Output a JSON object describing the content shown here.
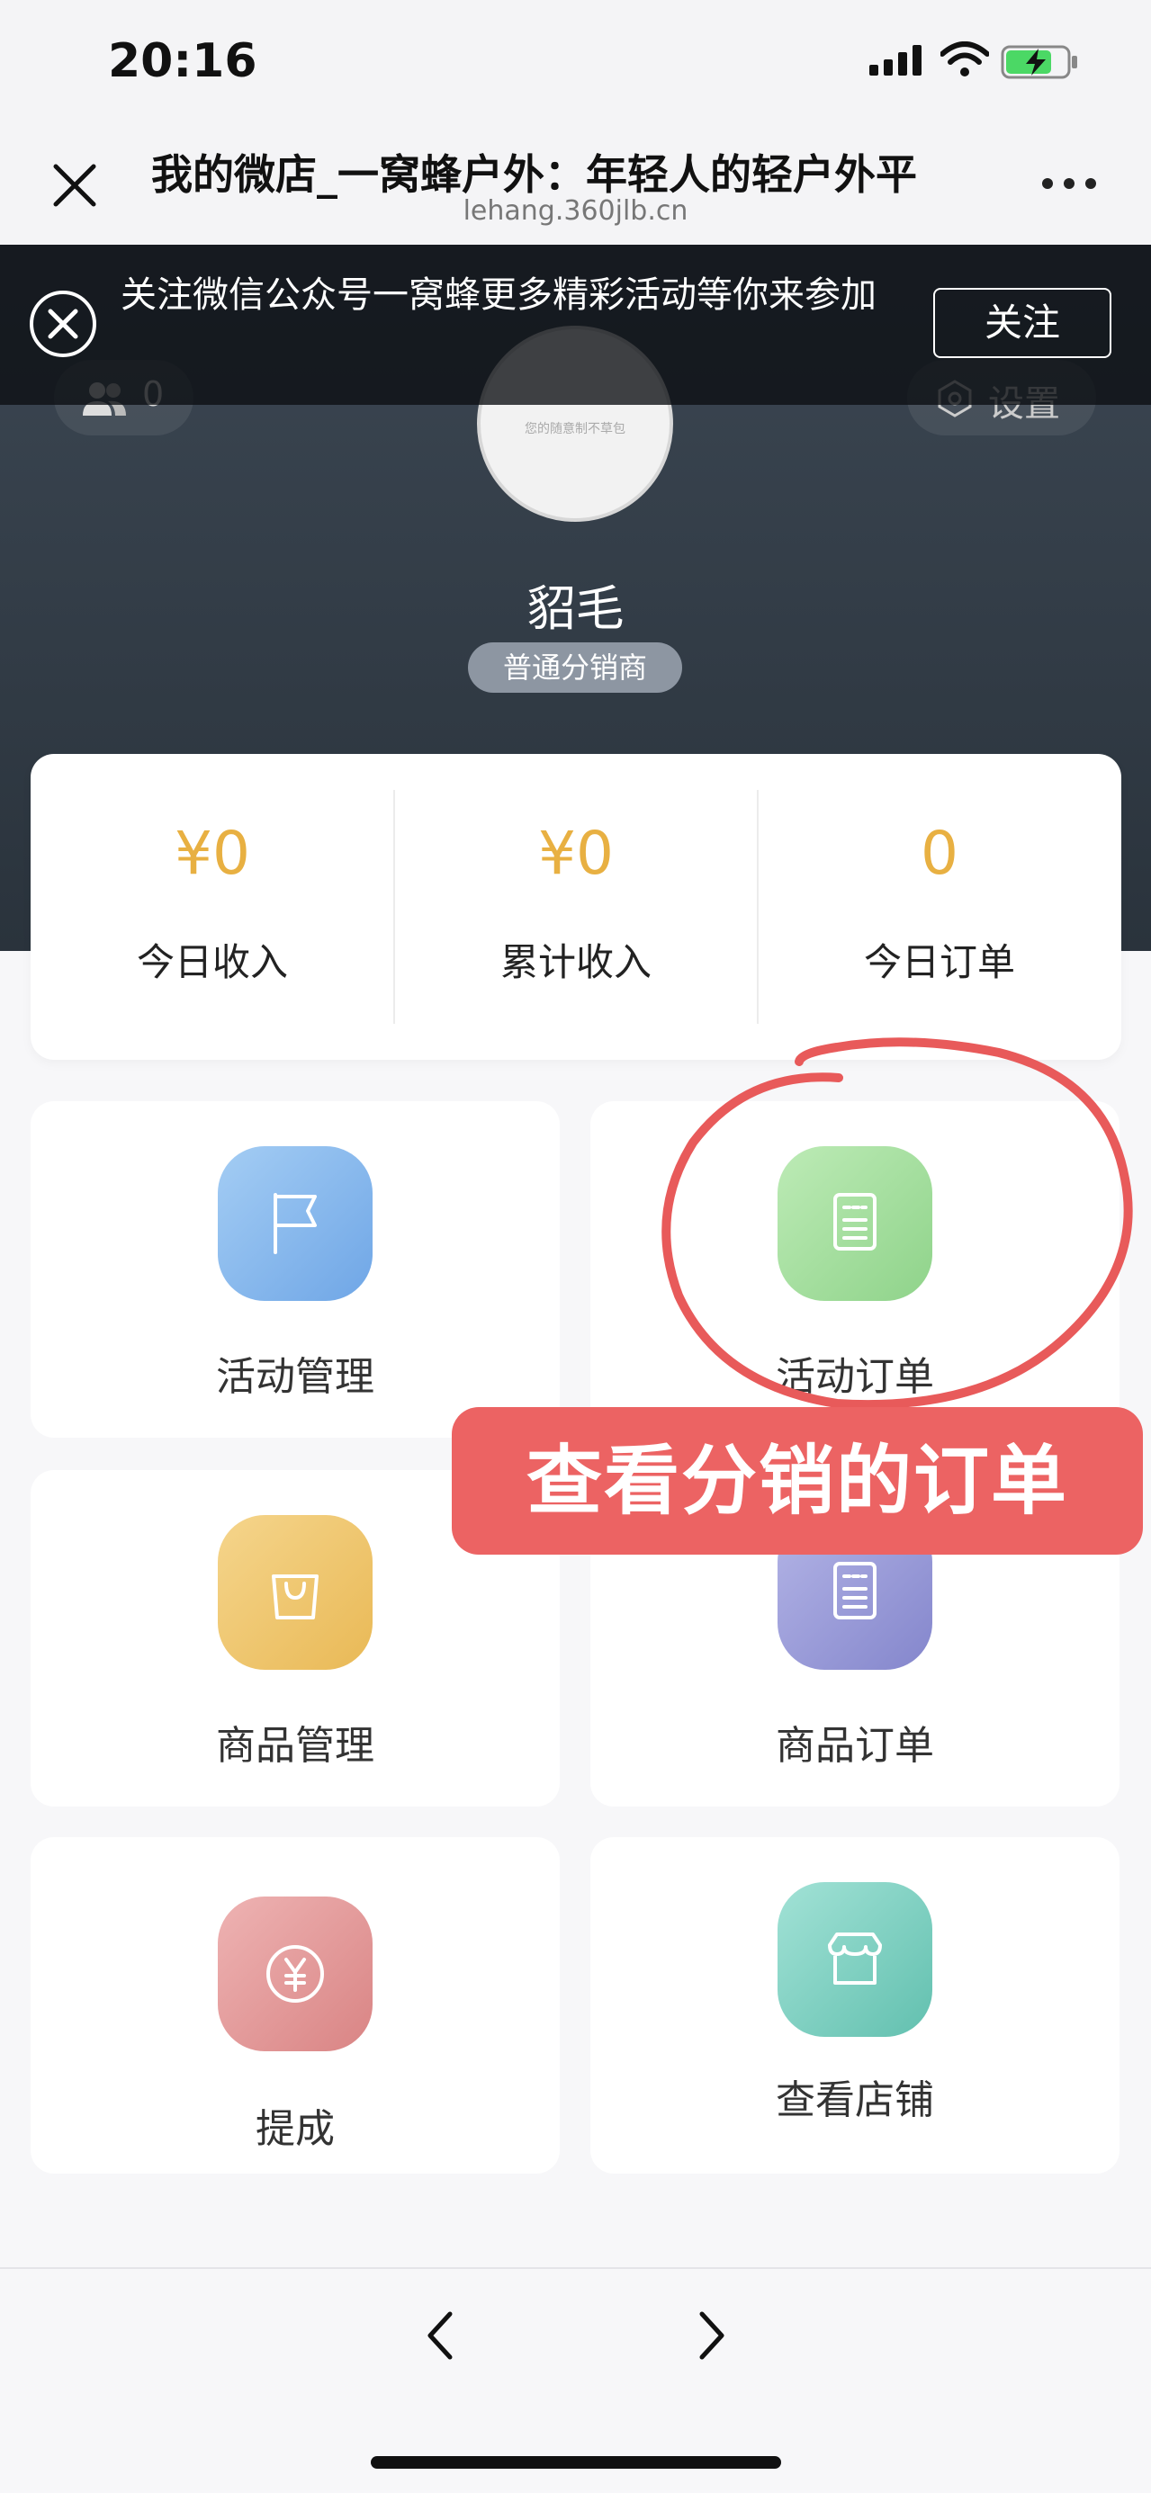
{
  "status_bar": {
    "time": "20:16"
  },
  "nav_bar": {
    "title": "我的微店_一窝蜂户外：年轻人的轻户外平",
    "url": "lehang.360jlb.cn"
  },
  "follow_banner": {
    "text": "关注微信公众号一窝蜂更多精彩活动等你来参加",
    "follow_button": "关注"
  },
  "profile": {
    "fans_count": "0",
    "settings_label": "设置",
    "avatar_caption": "您的随意制不草包",
    "username": "貂毛",
    "role": "普通分销商"
  },
  "stats": [
    {
      "value": "¥0",
      "label": "今日收入"
    },
    {
      "value": "¥0",
      "label": "累计收入"
    },
    {
      "value": "0",
      "label": "今日订单"
    }
  ],
  "menu": [
    {
      "label": "活动管理",
      "icon": "flag-icon",
      "color": "#7fb3ec"
    },
    {
      "label": "活动订单",
      "icon": "document-icon",
      "color": "#a6dfa0"
    },
    {
      "label": "商品管理",
      "icon": "shopping-bag-icon",
      "color": "#f0c76c"
    },
    {
      "label": "商品订单",
      "icon": "document-icon",
      "color": "#9c9fda"
    },
    {
      "label": "提成",
      "icon": "yen-coin-icon",
      "color": "#e0999a"
    },
    {
      "label": "查看店铺",
      "icon": "storefront-icon",
      "color": "#7fd0c2"
    }
  ],
  "annotation": {
    "label": "查看分销的订单",
    "color": "#ec6363"
  }
}
